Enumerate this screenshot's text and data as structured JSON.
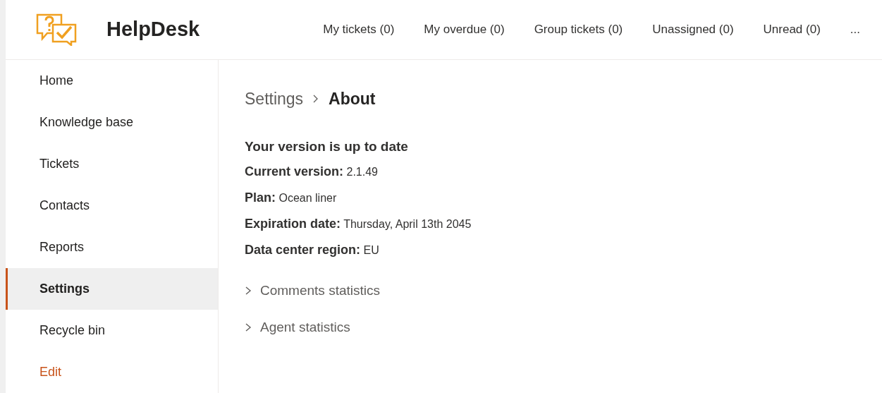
{
  "app": {
    "title": "HelpDesk"
  },
  "top_nav": [
    {
      "label": "My tickets (0)"
    },
    {
      "label": "My overdue (0)"
    },
    {
      "label": "Group tickets (0)"
    },
    {
      "label": "Unassigned (0)"
    },
    {
      "label": "Unread (0)"
    },
    {
      "label": "..."
    }
  ],
  "sidebar": {
    "items": [
      {
        "label": "Home",
        "selected": false,
        "kind": "nav"
      },
      {
        "label": "Knowledge base",
        "selected": false,
        "kind": "nav"
      },
      {
        "label": "Tickets",
        "selected": false,
        "kind": "nav"
      },
      {
        "label": "Contacts",
        "selected": false,
        "kind": "nav"
      },
      {
        "label": "Reports",
        "selected": false,
        "kind": "nav"
      },
      {
        "label": "Settings",
        "selected": true,
        "kind": "nav"
      },
      {
        "label": "Recycle bin",
        "selected": false,
        "kind": "nav"
      },
      {
        "label": "Edit",
        "selected": false,
        "kind": "link"
      }
    ]
  },
  "breadcrumb": [
    {
      "label": "Settings"
    },
    {
      "label": "About"
    }
  ],
  "about": {
    "heading": "Your version is up to date",
    "details": [
      {
        "label": "Current version:",
        "value": "2.1.49"
      },
      {
        "label": "Plan:",
        "value": "Ocean liner"
      },
      {
        "label": "Expiration date:",
        "value": "Thursday, April 13th 2045"
      },
      {
        "label": "Data center region:",
        "value": "EU"
      }
    ]
  },
  "sections": [
    {
      "label": "Comments statistics",
      "expanded": false
    },
    {
      "label": "Agent statistics",
      "expanded": false
    }
  ]
}
